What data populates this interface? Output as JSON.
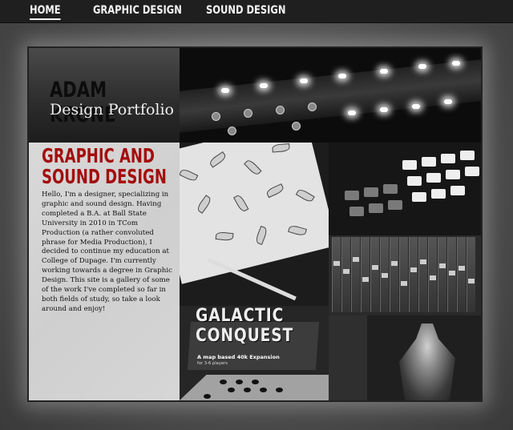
{
  "nav": {
    "items": [
      {
        "label": "HOME",
        "active": true
      },
      {
        "label": "GRAPHIC DESIGN",
        "active": false
      },
      {
        "label": "SOUND DESIGN",
        "active": false
      }
    ]
  },
  "header": {
    "name": "ADAM KRONE",
    "subtitle": "Design Portfolio"
  },
  "intro": {
    "title_line1": "GRAPHIC AND",
    "title_line2": "SOUND DESIGN",
    "body": "Hello, I'm a designer, specializing in graphic and sound design. Having completed a B.A. at Ball State University in 2010 in TCom Production (a rather convoluted phrase for Media Production), I decided to continue my education at College of Dupage. I'm currently working towards a degree in Graphic Design. This site is a gallery of some of the work I've completed so far in both fields of study, so take a look around and enjoy!"
  },
  "gallery": {
    "game_title": "GALACTIC CONQUEST",
    "game_tagline": "A map based 40k Expansion",
    "game_players": "for 3-6 players"
  },
  "colors": {
    "accent_red": "#a30d0d",
    "nav_bg": "#1f1f1f",
    "text_panel_bg": "#d6d6d6"
  }
}
